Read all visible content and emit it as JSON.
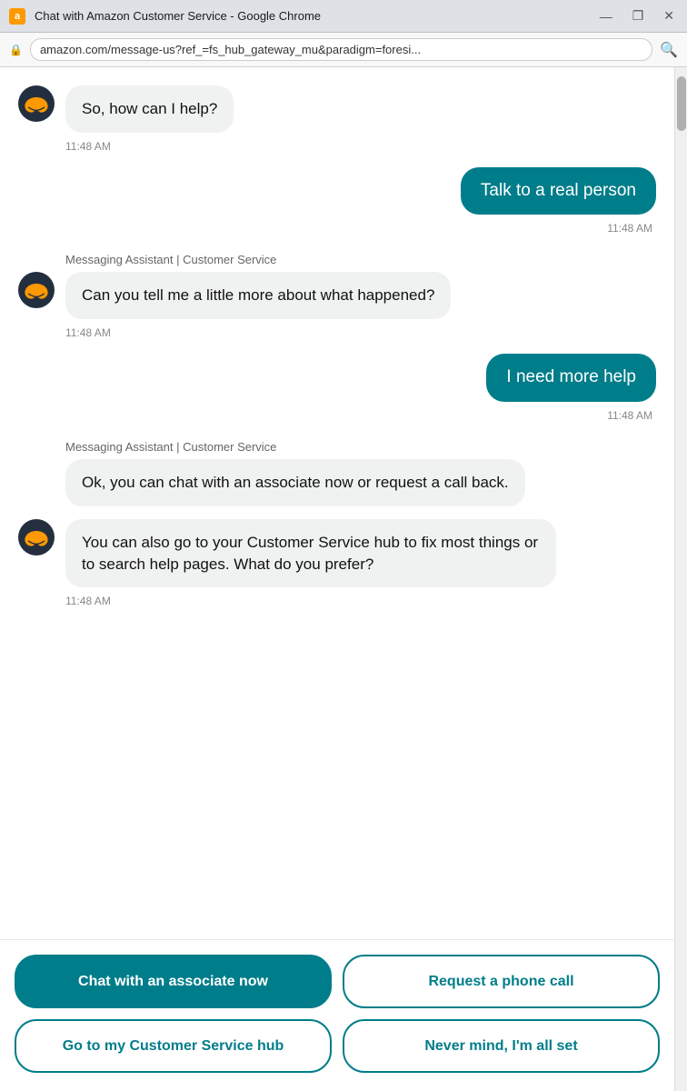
{
  "titleBar": {
    "icon": "a",
    "title": "Chat with Amazon Customer Service - Google Chrome",
    "minimize": "—",
    "maximize": "❐",
    "close": "✕"
  },
  "addressBar": {
    "url": "amazon.com/message-us?ref_=fs_hub_gateway_mu&paradigm=foresi...",
    "lock": "🔒"
  },
  "messages": [
    {
      "type": "bot",
      "text": "So, how can I help?",
      "time": "11:48 AM",
      "showAvatar": true
    },
    {
      "type": "user",
      "text": "Talk to a real person",
      "time": "11:48 AM"
    },
    {
      "type": "bot-label",
      "label": "Messaging Assistant | Customer Service"
    },
    {
      "type": "bot",
      "text": "Can you tell me a little more about what happened?",
      "time": "11:48 AM",
      "showAvatar": true
    },
    {
      "type": "user",
      "text": "I need more help",
      "time": "11:48 AM"
    },
    {
      "type": "bot-label",
      "label": "Messaging Assistant | Customer Service"
    },
    {
      "type": "bot",
      "text": "Ok, you can chat with an associate now or request a call back.",
      "showAvatar": false
    },
    {
      "type": "bot",
      "text": "You can also go to your Customer Service hub to fix most things or to search help pages. What do you prefer?",
      "time": "11:48 AM",
      "showAvatar": true
    }
  ],
  "actions": [
    {
      "label": "Chat with an associate now",
      "style": "filled"
    },
    {
      "label": "Request a phone call",
      "style": "outline"
    },
    {
      "label": "Go to my Customer Service hub",
      "style": "outline"
    },
    {
      "label": "Never mind, I'm all set",
      "style": "outline"
    }
  ]
}
